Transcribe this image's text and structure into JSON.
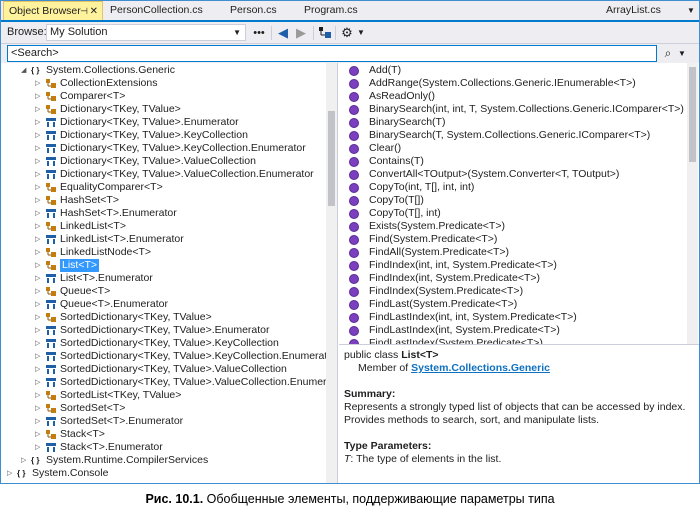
{
  "tabs": {
    "object_browser": "Object Browser",
    "person_collection": "PersonCollection.cs",
    "person": "Person.cs",
    "program": "Program.cs",
    "arraylist": "ArrayList.cs"
  },
  "toolbar": {
    "browse_label": "Browse:",
    "browse_value": "My Solution"
  },
  "search": {
    "placeholder": "<Search>"
  },
  "tree": {
    "root": "System.Collections.Generic",
    "items": [
      "CollectionExtensions",
      "Comparer<T>",
      "Dictionary<TKey, TValue>",
      "Dictionary<TKey, TValue>.Enumerator",
      "Dictionary<TKey, TValue>.KeyCollection",
      "Dictionary<TKey, TValue>.KeyCollection.Enumerator",
      "Dictionary<TKey, TValue>.ValueCollection",
      "Dictionary<TKey, TValue>.ValueCollection.Enumerator",
      "EqualityComparer<T>",
      "HashSet<T>",
      "HashSet<T>.Enumerator",
      "LinkedList<T>",
      "LinkedList<T>.Enumerator",
      "LinkedListNode<T>",
      "List<T>",
      "List<T>.Enumerator",
      "Queue<T>",
      "Queue<T>.Enumerator",
      "SortedDictionary<TKey, TValue>",
      "SortedDictionary<TKey, TValue>.Enumerator",
      "SortedDictionary<TKey, TValue>.KeyCollection",
      "SortedDictionary<TKey, TValue>.KeyCollection.Enumerator",
      "SortedDictionary<TKey, TValue>.ValueCollection",
      "SortedDictionary<TKey, TValue>.ValueCollection.Enumerator",
      "SortedList<TKey, TValue>",
      "SortedSet<T>",
      "SortedSet<T>.Enumerator",
      "Stack<T>",
      "Stack<T>.Enumerator"
    ],
    "next_ns": "System.Runtime.CompilerServices",
    "last_ns": "System.Console",
    "selected_index": 14
  },
  "members": [
    "Add(T)",
    "AddRange(System.Collections.Generic.IEnumerable<T>)",
    "AsReadOnly()",
    "BinarySearch(int, int, T, System.Collections.Generic.IComparer<T>)",
    "BinarySearch(T)",
    "BinarySearch(T, System.Collections.Generic.IComparer<T>)",
    "Clear()",
    "Contains(T)",
    "ConvertAll<TOutput>(System.Converter<T, TOutput>)",
    "CopyTo(int, T[], int, int)",
    "CopyTo(T[])",
    "CopyTo(T[], int)",
    "Exists(System.Predicate<T>)",
    "Find(System.Predicate<T>)",
    "FindAll(System.Predicate<T>)",
    "FindIndex(int, int, System.Predicate<T>)",
    "FindIndex(int, System.Predicate<T>)",
    "FindIndex(System.Predicate<T>)",
    "FindLast(System.Predicate<T>)",
    "FindLastIndex(int, int, System.Predicate<T>)",
    "FindLastIndex(int, System.Predicate<T>)",
    "FindLastIndex(System.Predicate<T>)"
  ],
  "description": {
    "decl_prefix": "public class ",
    "decl_name": "List<T>",
    "member_of_label": "Member of ",
    "member_of_link": "System.Collections.Generic",
    "summary_heading": "Summary:",
    "summary_text": "Represents a strongly typed list of objects that can be accessed by index. Provides methods to search, sort, and manipulate lists.",
    "type_params_heading": "Type Parameters:",
    "type_param_name": "T",
    "type_param_text": ": The type of elements in the list."
  },
  "caption": {
    "label": "Рис. 10.1.",
    "text": " Обобщенные элементы, поддерживающие параметры типа"
  },
  "colors": {
    "accent": "#007acc",
    "selection": "#3399ff",
    "method_icon": "#7b3fbf"
  }
}
